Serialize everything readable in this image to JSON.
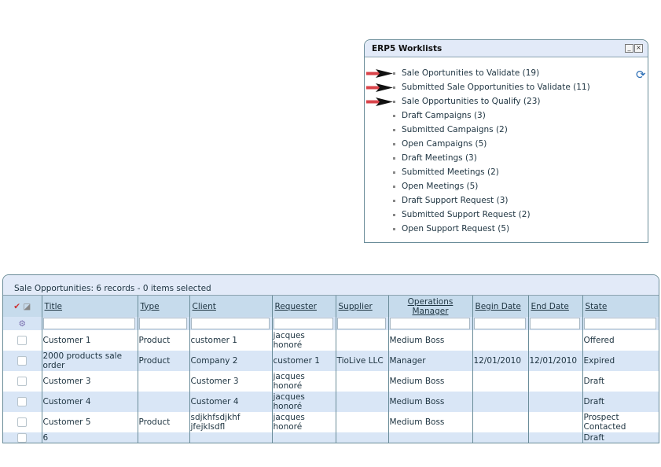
{
  "worklists": {
    "title": "ERP5 Worklists",
    "minimize_icon": "minimize-icon",
    "close_icon": "close-icon",
    "refresh_icon": "refresh-icon",
    "items": [
      {
        "label": "Sale Oportunities to Validate (19)",
        "arrow": true
      },
      {
        "label": "Submitted Sale Opportunities to Validate (11)",
        "arrow": true
      },
      {
        "label": "Sale Opportunities to Qualify (23)",
        "arrow": true
      },
      {
        "label": "Draft Campaigns (3)",
        "arrow": false
      },
      {
        "label": "Submitted Campaigns (2)",
        "arrow": false
      },
      {
        "label": "Open Campaigns (5)",
        "arrow": false
      },
      {
        "label": "Draft Meetings (3)",
        "arrow": false
      },
      {
        "label": "Submitted Meetings (2)",
        "arrow": false
      },
      {
        "label": "Open Meetings (5)",
        "arrow": false
      },
      {
        "label": "Draft Support Request (3)",
        "arrow": false
      },
      {
        "label": "Submitted Support Request (2)",
        "arrow": false
      },
      {
        "label": "Open Support Request (5)",
        "arrow": false
      }
    ]
  },
  "listbox": {
    "title": "Sale Opportunities: 6 records - 0 items selected",
    "columns": [
      "Title",
      "Type",
      "Client",
      "Requester",
      "Supplier",
      "Operations Manager",
      "Begin Date",
      "End Date",
      "State"
    ],
    "rows": [
      [
        "Customer 1",
        "Product",
        "customer 1",
        "jacques honoré",
        "",
        "Medium Boss",
        "",
        "",
        "Offered"
      ],
      [
        "2000 products sale order",
        "Product",
        "Company 2",
        "customer 1",
        "TioLive LLC",
        "Manager",
        "12/01/2010",
        "12/01/2010",
        "Expired"
      ],
      [
        "Customer 3",
        "",
        "Customer 3",
        "jacques honoré",
        "",
        "Medium Boss",
        "",
        "",
        "Draft"
      ],
      [
        "Customer 4",
        "",
        "Customer 4",
        "jacques honoré",
        "",
        "Medium Boss",
        "",
        "",
        "Draft"
      ],
      [
        "Customer 5",
        "Product",
        "sdjkhfsdjkhf jfejklsdfl",
        "jacques honoré",
        "",
        "Medium Boss",
        "",
        "",
        "Prospect Contacted"
      ],
      [
        "6",
        "",
        "",
        "",
        "",
        "",
        "",
        "",
        "Draft"
      ]
    ]
  },
  "colors": {
    "header": "#c6dbec",
    "title_bar": "#e2eaf8",
    "row_alt": "#d9e6f6",
    "border": "#6a8c99",
    "arrow": "#d9434a"
  }
}
